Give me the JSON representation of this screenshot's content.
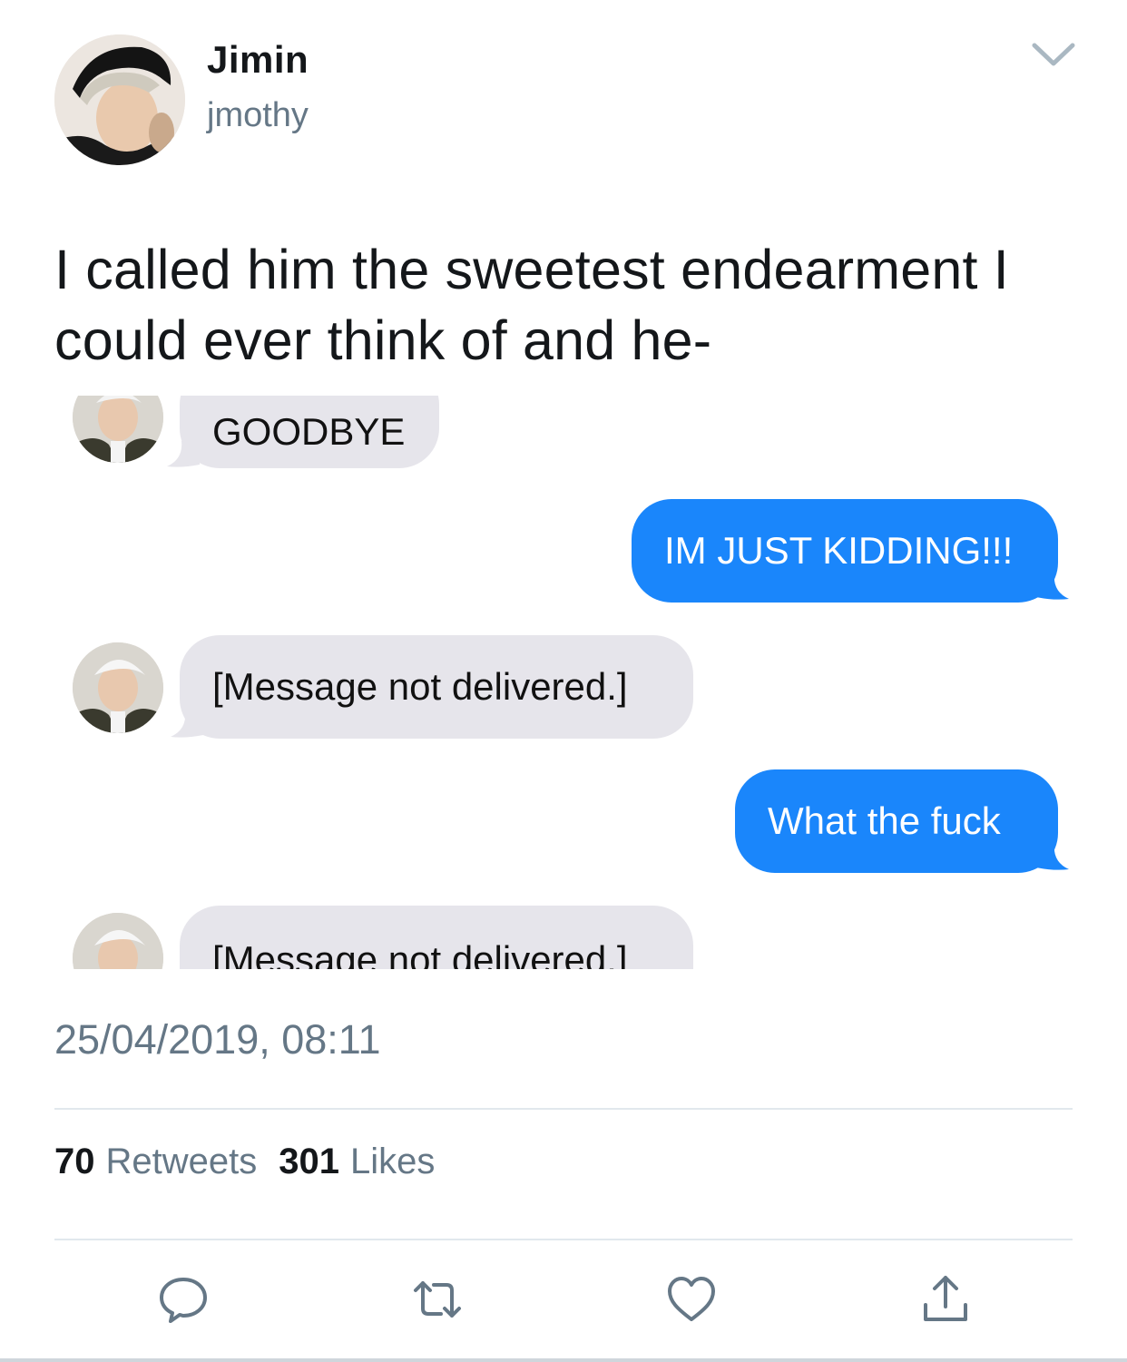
{
  "tweet": {
    "display_name": "Jimin",
    "handle": "jmothy",
    "text_line1": "I called him the sweetest endearment I",
    "text_line2": "could ever think of and he-",
    "timestamp": "25/04/2019, 08:11"
  },
  "media": {
    "messages": [
      {
        "from": "them",
        "text": "GOODBYE"
      },
      {
        "from": "me",
        "text": "IM JUST KIDDING!!!"
      },
      {
        "from": "them",
        "text": "[Message not delivered.]"
      },
      {
        "from": "me",
        "text": "What the fuck"
      },
      {
        "from": "them",
        "text": "[Message not delivered.]"
      }
    ]
  },
  "stats": {
    "retweets_count": "70",
    "retweets_label": "Retweets",
    "likes_count": "301",
    "likes_label": "Likes"
  },
  "icons": [
    "chevron-down-icon",
    "reply-icon",
    "retweet-icon",
    "like-icon",
    "share-icon"
  ],
  "colors": {
    "sent_bubble": "#1a86fb",
    "received_bubble": "#e6e5eb",
    "secondary_text": "#657786"
  }
}
